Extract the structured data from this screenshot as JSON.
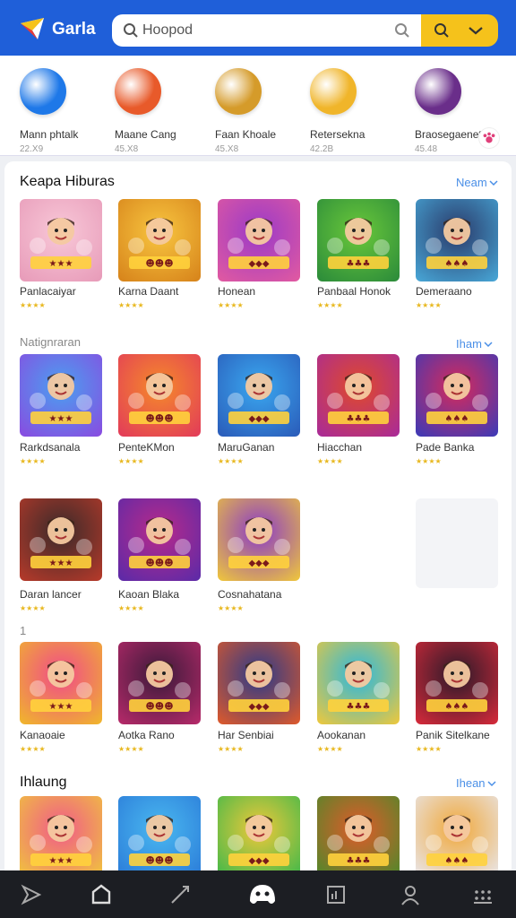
{
  "header": {
    "app_name": "Garla",
    "search": {
      "value": "Hoopod",
      "placeholder": "Hoopod"
    }
  },
  "categories": [
    {
      "name": "Mann phtalk",
      "count": "22.X9",
      "icon": "chat-bubble-icon",
      "color": "#1e78e8"
    },
    {
      "name": "Maane Cang",
      "count": "45.X8",
      "icon": "shield-emblem-icon",
      "color": "#e85a2a"
    },
    {
      "name": "Faan Khoale",
      "count": "45.X8",
      "icon": "treasure-chest-icon",
      "color": "#d59b2a"
    },
    {
      "name": "Retersekna",
      "count": "42.2B",
      "icon": "envelope-icon",
      "color": "#f0b52a"
    },
    {
      "name": "Braosegaenet",
      "count": "45.48",
      "icon": "galaxy-icon",
      "color": "#6a2e8a"
    }
  ],
  "sections": [
    {
      "title": "Keapa Hiburas",
      "more": "Neam",
      "games": [
        {
          "name": "Panlacaiyar",
          "rating": 4,
          "colors": [
            "#f8c8d8",
            "#e79ab8"
          ]
        },
        {
          "name": "Karna Daant",
          "rating": 4,
          "colors": [
            "#f8c640",
            "#d6821a"
          ]
        },
        {
          "name": "Honean",
          "rating": 4,
          "colors": [
            "#9a3ac8",
            "#e25aa0"
          ]
        },
        {
          "name": "Panbaal Honok",
          "rating": 4,
          "colors": [
            "#6ac83a",
            "#2a8a3a"
          ]
        },
        {
          "name": "Demeraano",
          "rating": 4,
          "colors": [
            "#2a3a6a",
            "#48a8d8"
          ]
        }
      ]
    },
    {
      "title": "Natignraran",
      "more": "Iham",
      "games": [
        {
          "name": "Rarkdsanala",
          "rating": 4,
          "colors": [
            "#4aa0f0",
            "#8a4ae0"
          ]
        },
        {
          "name": "PenteKMon",
          "rating": 4,
          "colors": [
            "#f58a2a",
            "#e23a5a"
          ]
        },
        {
          "name": "MaruGanan",
          "rating": 4,
          "colors": [
            "#3aa8f0",
            "#2a5ab8"
          ]
        },
        {
          "name": "Hiacchan",
          "rating": 4,
          "colors": [
            "#e04a2a",
            "#a82a9a"
          ]
        },
        {
          "name": "Pade Banka",
          "rating": 4,
          "colors": [
            "#d82a5a",
            "#3a3ab8"
          ]
        }
      ]
    },
    {
      "title": "",
      "more": "",
      "games": [
        {
          "name": "Daran lancer",
          "rating": 4,
          "colors": [
            "#3a2a2a",
            "#b83a2a"
          ]
        },
        {
          "name": "Kaoan Blaka",
          "rating": 4,
          "colors": [
            "#b82a8a",
            "#5a2aa8"
          ]
        },
        {
          "name": "Cosnahatana",
          "rating": 4,
          "colors": [
            "#8a3ac8",
            "#f0c83a"
          ]
        }
      ]
    },
    {
      "title": "1",
      "more": "",
      "games": [
        {
          "name": "Kanaoaie",
          "rating": 4,
          "colors": [
            "#f04a8a",
            "#f0b82a"
          ]
        },
        {
          "name": "Aotka Rano",
          "rating": 4,
          "colors": [
            "#3a1a3a",
            "#b82a6a"
          ]
        },
        {
          "name": "Har Senbiai",
          "rating": 4,
          "colors": [
            "#2a3a8a",
            "#e05a2a"
          ]
        },
        {
          "name": "Aookanan",
          "rating": 4,
          "colors": [
            "#2ab8e0",
            "#f0c83a"
          ]
        },
        {
          "name": "Panik Sitelkane",
          "rating": 4,
          "colors": [
            "#2a1a2a",
            "#d82a3a"
          ]
        }
      ]
    },
    {
      "title": "Ihlaung",
      "more": "Ihean",
      "games": [
        {
          "name": "",
          "rating": 0,
          "colors": [
            "#f05a8a",
            "#f0c83a"
          ]
        },
        {
          "name": "",
          "rating": 0,
          "colors": [
            "#4ab8f0",
            "#2a7ad8"
          ]
        },
        {
          "name": "",
          "rating": 0,
          "colors": [
            "#f0c83a",
            "#3ab84a"
          ]
        },
        {
          "name": "",
          "rating": 0,
          "colors": [
            "#e05a2a",
            "#4a8a2a"
          ]
        },
        {
          "name": "",
          "rating": 0,
          "colors": [
            "#f0a83a",
            "#e8e8f0"
          ]
        }
      ]
    }
  ],
  "bottom_nav": [
    {
      "icon": "send-icon"
    },
    {
      "icon": "home-icon"
    },
    {
      "icon": "edit-icon"
    },
    {
      "icon": "gamepad-icon",
      "active": true
    },
    {
      "icon": "chart-icon"
    },
    {
      "icon": "profile-icon"
    },
    {
      "icon": "grid-menu-icon"
    }
  ],
  "colors": {
    "primary": "#1f5fd9",
    "accent": "#f5c21b",
    "link": "#4a8fe7",
    "star": "#e8b820",
    "nav_bg": "#1c1e23"
  }
}
